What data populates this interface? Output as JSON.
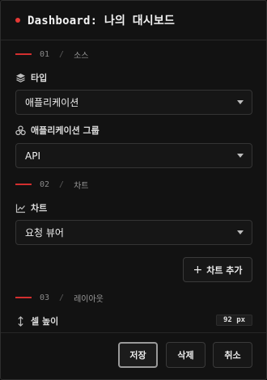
{
  "header": {
    "title": "Dashboard: 나의 대시보드"
  },
  "sections": {
    "source": {
      "num": "01",
      "slash": "/",
      "name": "소스"
    },
    "chart": {
      "num": "02",
      "slash": "/",
      "name": "차트"
    },
    "layout": {
      "num": "03",
      "slash": "/",
      "name": "레이아웃"
    }
  },
  "fields": {
    "type": {
      "label": "타입",
      "value": "애플리케이션",
      "icon": "layers-icon"
    },
    "app_group": {
      "label": "애플리케이션 그룹",
      "value": "API",
      "icon": "group-icon"
    },
    "chart": {
      "label": "차트",
      "value": "요청 뷰어",
      "icon": "line-chart-icon"
    },
    "cell_height": {
      "label": "셀 높이",
      "value": "92 px",
      "icon": "vertical-resize-icon"
    }
  },
  "buttons": {
    "add_chart": "차트 추가",
    "save": "저장",
    "delete": "삭제",
    "cancel": "취소"
  },
  "colors": {
    "accent": "#d32f2f",
    "background": "#121212",
    "border": "#343434"
  }
}
